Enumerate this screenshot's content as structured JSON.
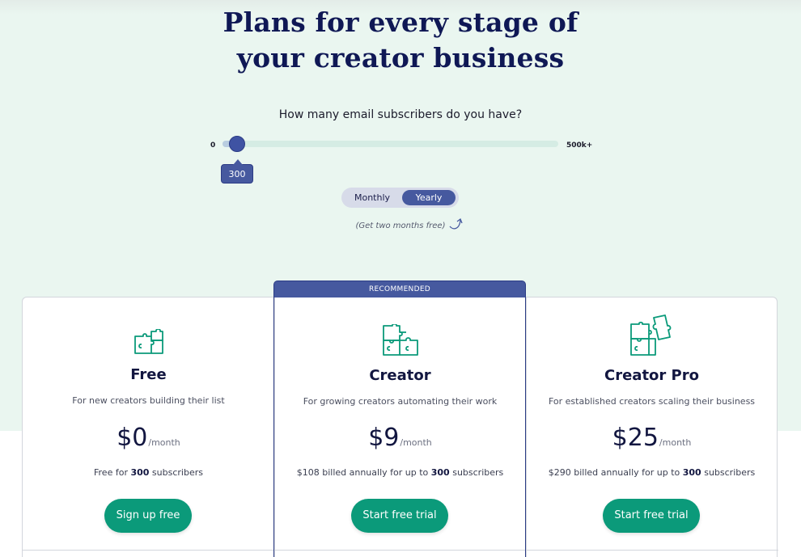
{
  "hero": {
    "title_line1": "Plans for every stage of",
    "title_line2": "your creator business",
    "question": "How many email subscribers do you have?"
  },
  "slider": {
    "min_label": "0",
    "max_label": "500k+",
    "value_label": "300",
    "value": 300
  },
  "billing_toggle": {
    "monthly": "Monthly",
    "yearly": "Yearly",
    "selected": "Yearly",
    "promo": "(Get two months free)"
  },
  "recommended_label": "RECOMMENDED",
  "colors": {
    "hero_bg": "#eaf6f0",
    "accent": "#46599f",
    "cta": "#0b9a7a",
    "icon": "#0b9a7a"
  },
  "plans": [
    {
      "name": "Free",
      "desc": "For new creators building their list",
      "price": "$0",
      "per": "/month",
      "note_prefix": "Free for ",
      "note_count": "300",
      "note_suffix": " subscribers",
      "cta": "Sign up free",
      "icon": "puzzle-piece-icon"
    },
    {
      "name": "Creator",
      "desc": "For growing creators automating their work",
      "price": "$9",
      "per": "/month",
      "note_prefix": "$108 billed annually for up to ",
      "note_count": "300",
      "note_suffix": " subscribers",
      "cta": "Start free trial",
      "icon": "puzzle-pieces-icon"
    },
    {
      "name": "Creator Pro",
      "desc": "For established creators scaling their business",
      "price": "$25",
      "per": "/month",
      "note_prefix": "$290 billed annually for up to ",
      "note_count": "300",
      "note_suffix": " subscribers",
      "cta": "Start free trial",
      "icon": "puzzle-set-icon"
    }
  ]
}
